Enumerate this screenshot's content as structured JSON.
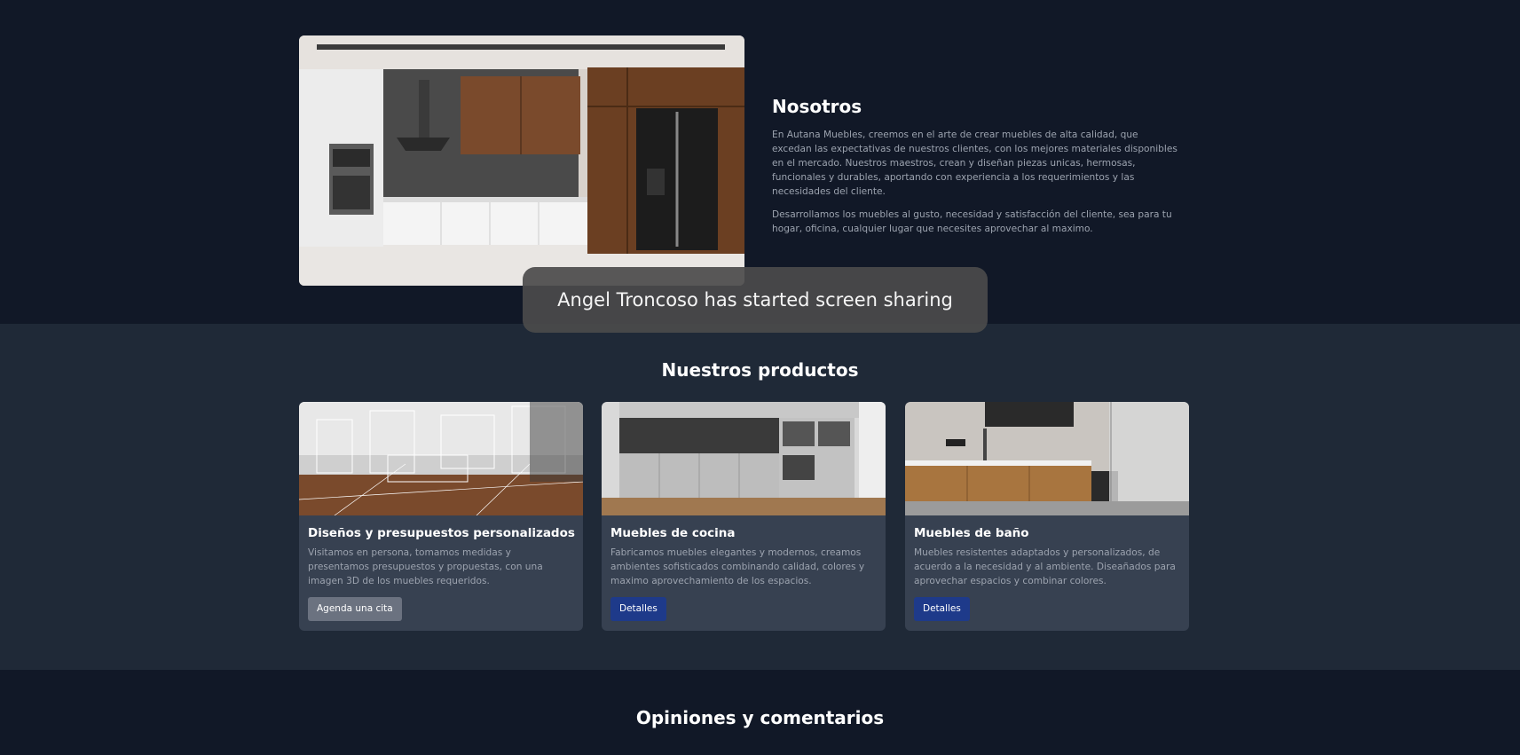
{
  "about": {
    "title": "Nosotros",
    "paragraph1": "En Autana Muebles, creemos en el arte de crear muebles de alta calidad, que excedan las expectativas de nuestros clientes, con los mejores materiales disponibles en el mercado. Nuestros maestros, crean y diseñan piezas unicas, hermosas, funcionales y durables, aportando con experiencia a los requerimientos y las necesidades del cliente.",
    "paragraph2": "Desarrollamos los muebles al gusto, necesidad y satisfacción del cliente, sea para tu hogar, oficina, cualquier lugar que necesites aprovechar al maximo."
  },
  "products": {
    "title": "Nuestros productos",
    "cards": [
      {
        "title": "Diseños y presupuestos personalizados",
        "description": "Visitamos en persona, tomamos medidas y presentamos presupuestos y propuestas, con una imagen 3D de los muebles requeridos.",
        "button": "Agenda una cita"
      },
      {
        "title": "Muebles de cocina",
        "description": "Fabricamos muebles elegantes y modernos, creamos ambientes sofisticados combinando calidad, colores y maximo aprovechamiento de los espacios.",
        "button": "Detalles"
      },
      {
        "title": "Muebles de baño",
        "description": "Muebles resistentes adaptados y personalizados, de acuerdo a la necesidad y al ambiente. Diseañados para aprovechar espacios y combinar colores.",
        "button": "Detalles"
      }
    ]
  },
  "reviews": {
    "title": "Opiniones y comentarios"
  },
  "toast": {
    "message": "Angel Troncoso has started screen sharing"
  },
  "colors": {
    "page_bg": "#111827",
    "section_bg": "#1f2937",
    "card_bg": "#374151",
    "button_primary": "#1e3a8a",
    "button_secondary": "#6b7280"
  }
}
